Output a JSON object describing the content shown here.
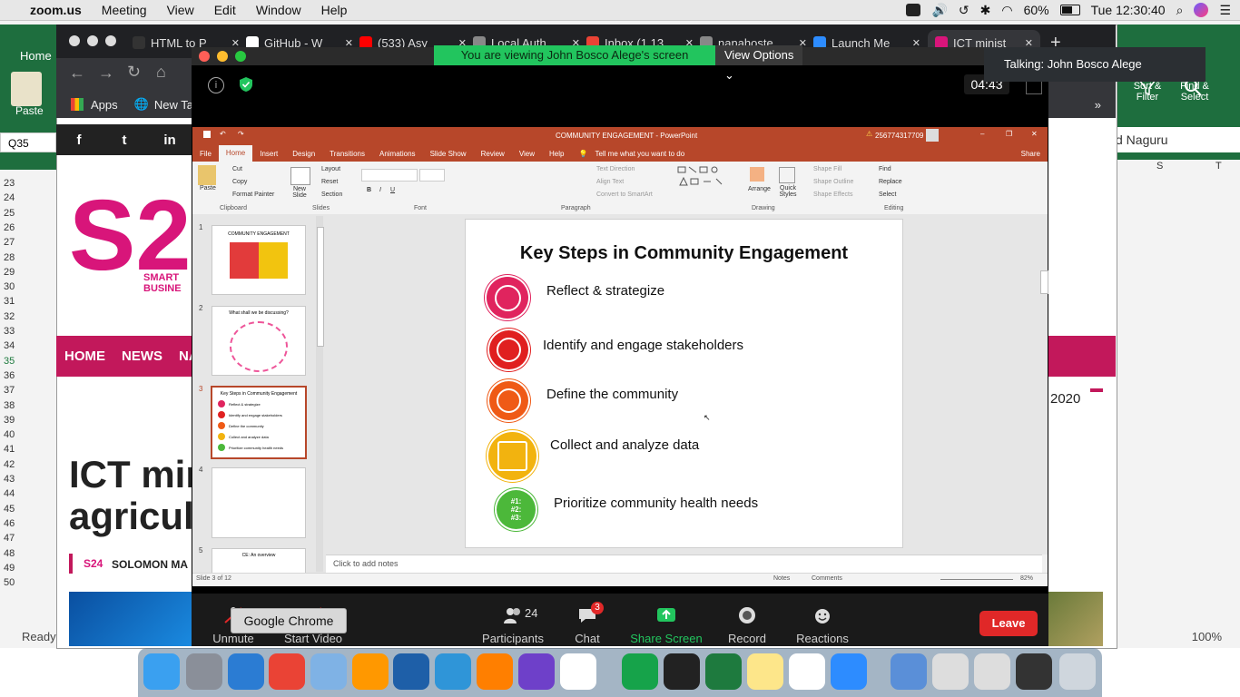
{
  "menubar": {
    "app_name": "zoom.us",
    "items": [
      "Meeting",
      "View",
      "Edit",
      "Window",
      "Help"
    ],
    "battery": "60%",
    "clock": "Tue 12:30:40"
  },
  "chrome": {
    "tabs": [
      "HTML to P",
      "GitHub - W",
      "(533) Asy",
      "Local Auth",
      "Inbox (1,13",
      "nanahoste",
      "Launch Me",
      "ICT minist"
    ],
    "bookmarks": {
      "apps": "Apps",
      "new_tab": "New Tal"
    },
    "social": [
      "f",
      "t",
      "in"
    ]
  },
  "excel": {
    "ribbon": {
      "paste": "Paste",
      "sort_filter": "Sort & Filter",
      "find_select": "Find & Select"
    },
    "name_box": "Q35",
    "home_tab": "Home",
    "cell_right": "d Naguru",
    "col_s": "S",
    "col_t": "T",
    "row_numbers": [
      "23",
      "24",
      "25",
      "26",
      "27",
      "28",
      "29",
      "30",
      "31",
      "32",
      "33",
      "34",
      "35",
      "36",
      "37",
      "38",
      "39",
      "40",
      "41",
      "42",
      "43",
      "44",
      "45",
      "46",
      "47",
      "48",
      "49",
      "50"
    ],
    "status_ready": "Ready",
    "zoom_percent": "100%",
    "year_text": "2020"
  },
  "website": {
    "logo_text": "S24",
    "logo_sub": "SMART BUSINE",
    "nav": [
      "HOME",
      "NEWS",
      "NAT"
    ],
    "headline_line1": "ICT mini",
    "headline_line2": "agricult",
    "author": "SOLOMON MA"
  },
  "zoom": {
    "viewing_banner": "You are viewing John Bosco Alege's screen",
    "view_options": "View Options",
    "talking": "Talking: John Bosco Alege",
    "timer": "04:43",
    "controls": {
      "unmute": "Unmute",
      "start_video": "Start Video",
      "participants": "Participants",
      "participants_count": "24",
      "chat": "Chat",
      "chat_badge": "3",
      "share_screen": "Share Screen",
      "record": "Record",
      "reactions": "Reactions",
      "leave": "Leave"
    },
    "tooltip": "Google Chrome"
  },
  "powerpoint": {
    "title": "COMMUNITY ENGAGEMENT - PowerPoint",
    "phone": "256774317709",
    "tabs": [
      "File",
      "Home",
      "Insert",
      "Design",
      "Transitions",
      "Animations",
      "Slide Show",
      "Review",
      "View",
      "Help"
    ],
    "tell_me": "Tell me what you want to do",
    "share": "Share",
    "ribbon": {
      "paste": "Paste",
      "cut": "Cut",
      "copy": "Copy",
      "format_painter": "Format Painter",
      "clipboard": "Clipboard",
      "new_slide": "New Slide",
      "layout": "Layout",
      "reset": "Reset",
      "section": "Section",
      "slides": "Slides",
      "font": "Font",
      "text_direction": "Text Direction",
      "align_text": "Align Text",
      "convert_smartart": "Convert to SmartArt",
      "paragraph": "Paragraph",
      "arrange": "Arrange",
      "quick_styles": "Quick Styles",
      "shape_fill": "Shape Fill",
      "shape_outline": "Shape Outline",
      "shape_effects": "Shape Effects",
      "drawing": "Drawing",
      "find": "Find",
      "replace": "Replace",
      "select": "Select",
      "editing": "Editing"
    },
    "thumbnails": [
      {
        "num": "1",
        "title": "COMMUNITY ENGAGEMENT"
      },
      {
        "num": "2",
        "title": "What shall we be discussing?"
      },
      {
        "num": "3",
        "title": "Key Steps in Community Engagement"
      },
      {
        "num": "4",
        "title": ""
      },
      {
        "num": "5",
        "title": "CE: An overview"
      }
    ],
    "slide": {
      "title": "Key Steps in Community Engagement",
      "steps": [
        {
          "label": "Reflect & strategize",
          "color": "#e0245e"
        },
        {
          "label": "Identify and engage stakeholders",
          "color": "#e02020"
        },
        {
          "label": "Define the community",
          "color": "#ef5a16"
        },
        {
          "label": "Collect and analyze data",
          "color": "#f2b30f"
        },
        {
          "label": "Prioritize community health needs",
          "color": "#4cb83a",
          "icon_text": "#1: #2: #3:"
        }
      ]
    },
    "notes_placeholder": "Click to add notes",
    "status": {
      "slide_of": "Slide 3 of 12",
      "notes": "Notes",
      "comments": "Comments",
      "zoom": "82%"
    }
  }
}
